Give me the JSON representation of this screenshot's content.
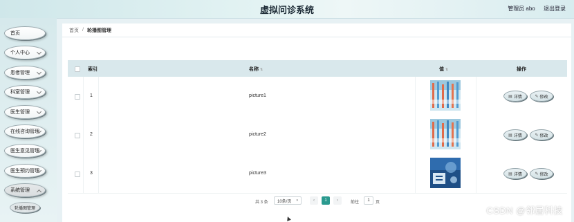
{
  "header": {
    "title": "虚拟问诊系统",
    "user_label": "管理员 abo",
    "logout_label": "退出登录"
  },
  "sidebar": {
    "items": [
      {
        "label": "首页",
        "has_chevron": false
      },
      {
        "label": "个人中心",
        "has_chevron": true
      },
      {
        "label": "患者管理",
        "has_chevron": true
      },
      {
        "label": "科室管理",
        "has_chevron": true
      },
      {
        "label": "医生管理",
        "has_chevron": true
      },
      {
        "label": "在线咨询管理",
        "has_chevron": true
      },
      {
        "label": "医生意见管理",
        "has_chevron": true
      },
      {
        "label": "医生预约管理",
        "has_chevron": true
      },
      {
        "label": "系统管理",
        "has_chevron": true
      }
    ],
    "subitem": "轮播图管理"
  },
  "breadcrumb": {
    "home": "首页",
    "separator": "/",
    "current": "轮播图管理"
  },
  "table": {
    "columns": {
      "index": "索引",
      "name": "名称",
      "value": "值",
      "actions": "操作"
    },
    "rows": [
      {
        "index": "1",
        "name": "picture1",
        "image": "image-1"
      },
      {
        "index": "2",
        "name": "picture2",
        "image": "image-2"
      },
      {
        "index": "3",
        "name": "picture3",
        "image": "image-3"
      }
    ],
    "detail_label": "详情",
    "edit_label": "修改"
  },
  "pagination": {
    "total": "共 3 条",
    "page_size": "10条/页",
    "current_page": "1",
    "goto_label": "前往",
    "goto_value": "1",
    "goto_suffix": "页"
  },
  "watermark": "CSDN @邻居科技",
  "colors": {
    "accent": "#2a9a8f",
    "header_bg": "#d9e8ec",
    "sidebar_bg": "#d6e9ec"
  }
}
